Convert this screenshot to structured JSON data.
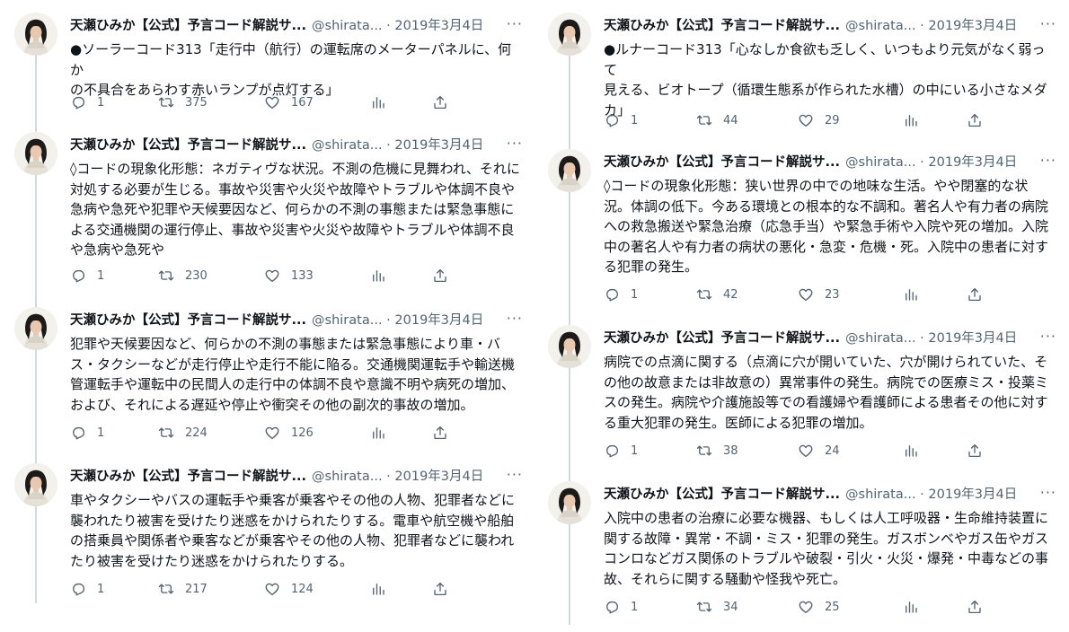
{
  "left_column": {
    "tweets": [
      {
        "name": "天瀬ひみか【公式】予言コード解説サ...",
        "handle": "@shirata...",
        "date": "· 2019年3月4日",
        "more": "···",
        "text_lines": [
          "●ソーラーコード313「走行中（航行）の運転席のメーターパネルに、何か",
          "の不具合をあらわす赤いランプが点灯する」"
        ],
        "replies": "1",
        "retweets": "375",
        "likes": "167"
      },
      {
        "name": "天瀬ひみか【公式】予言コード解説サ...",
        "handle": "@shirata...",
        "date": "· 2019年3月4日",
        "more": "···",
        "text_lines": [
          "◊コードの現象化形態：ネガティヴな状況。不測の危機に見舞われ、それに",
          "対処する必要が生じる。事故や災害や火災や故障やトラブルや体調不良や",
          "急病や急死や犯罪や天候要因など、何らかの不測の事態または緊急事態に",
          "よる交通機関の運行停止、事故や災害や火災や故障やトラブルや体調不良",
          "や急病や急死や"
        ],
        "replies": "1",
        "retweets": "230",
        "likes": "133"
      },
      {
        "name": "天瀬ひみか【公式】予言コード解説サ...",
        "handle": "@shirata...",
        "date": "· 2019年3月4日",
        "more": "···",
        "text_lines": [
          "犯罪や天候要因など、何らかの不測の事態または緊急事態により車・バ",
          "ス・タクシーなどが走行停止や走行不能に陥る。交通機関運転手や輸送機",
          "管運転手や運転中の民間人の走行中の体調不良や意識不明や病死の増加、",
          "および、それによる遅延や停止や衝突その他の副次的事故の増加。"
        ],
        "replies": "1",
        "retweets": "224",
        "likes": "126"
      },
      {
        "name": "天瀬ひみか【公式】予言コード解説サ...",
        "handle": "@shirata...",
        "date": "· 2019年3月4日",
        "more": "···",
        "text_lines": [
          "車やタクシーやバスの運転手や乗客が乗客やその他の人物、犯罪者などに",
          "襲われたり被害を受けたり迷惑をかけられたりする。電車や航空機や船舶",
          "の搭乗員や関係者や乗客などが乗客やその他の人物、犯罪者などに襲われ",
          "たり被害を受けたり迷惑をかけられたりする。"
        ],
        "replies": "1",
        "retweets": "217",
        "likes": "124"
      }
    ]
  },
  "right_column": {
    "tweets": [
      {
        "name": "天瀬ひみか【公式】予言コード解説サ...",
        "handle": "@shirata...",
        "date": "· 2019年3月4日",
        "more": "···",
        "text_lines": [
          "●ルナーコード313「心なしか食欲も乏しく、いつもより元気がなく弱って",
          "見える、ビオトープ（循環生態系が作られた水槽）の中にいる小さなメダ",
          "カ」"
        ],
        "replies": "1",
        "retweets": "44",
        "likes": "29"
      },
      {
        "name": "天瀬ひみか【公式】予言コード解説サ...",
        "handle": "@shirata...",
        "date": "· 2019年3月4日",
        "more": "···",
        "text_lines": [
          "◊コードの現象化形態：狭い世界の中での地味な生活。やや閉塞的な状",
          "況。体調の低下。今ある環境との根本的な不調和。著名人や有力者の病院",
          "への救急搬送や緊急治療（応急手当）や緊急手術や入院や死の増加。入院",
          "中の著名人や有力者の病状の悪化・急変・危機・死。入院中の患者に対す",
          "る犯罪の発生。"
        ],
        "replies": "1",
        "retweets": "42",
        "likes": "23"
      },
      {
        "name": "天瀬ひみか【公式】予言コード解説サ...",
        "handle": "@shirata...",
        "date": "· 2019年3月4日",
        "more": "···",
        "text_lines": [
          "病院での点滴に関する（点滴に穴が開いていた、穴が開けられていた、そ",
          "の他の故意または非故意の）異常事件の発生。病院での医療ミス・投薬ミ",
          "スの発生。病院や介護施設等での看護婦や看護師による患者その他に対す",
          "る重大犯罪の発生。医師による犯罪の増加。"
        ],
        "replies": "1",
        "retweets": "38",
        "likes": "24"
      },
      {
        "name": "天瀬ひみか【公式】予言コード解説サ...",
        "handle": "@shirata...",
        "date": "· 2019年3月4日",
        "more": "···",
        "text_lines": [
          "入院中の患者の治療に必要な機器、もしくは人工呼吸器・生命維持装置に",
          "関する故障・異常・不調・ミス・犯罪の発生。ガスボンベやガス缶やガス",
          "コンロなどガス関係のトラブルや破裂・引火・火災・爆発・中毒などの事",
          "故、それらに関する騒動や怪我や死亡。"
        ],
        "replies": "1",
        "retweets": "34",
        "likes": "25"
      }
    ]
  },
  "icons": {
    "reply": "reply-icon",
    "retweet": "retweet-icon",
    "like": "heart-icon",
    "analytics": "analytics-icon",
    "share": "share-icon",
    "more": "more-icon"
  }
}
